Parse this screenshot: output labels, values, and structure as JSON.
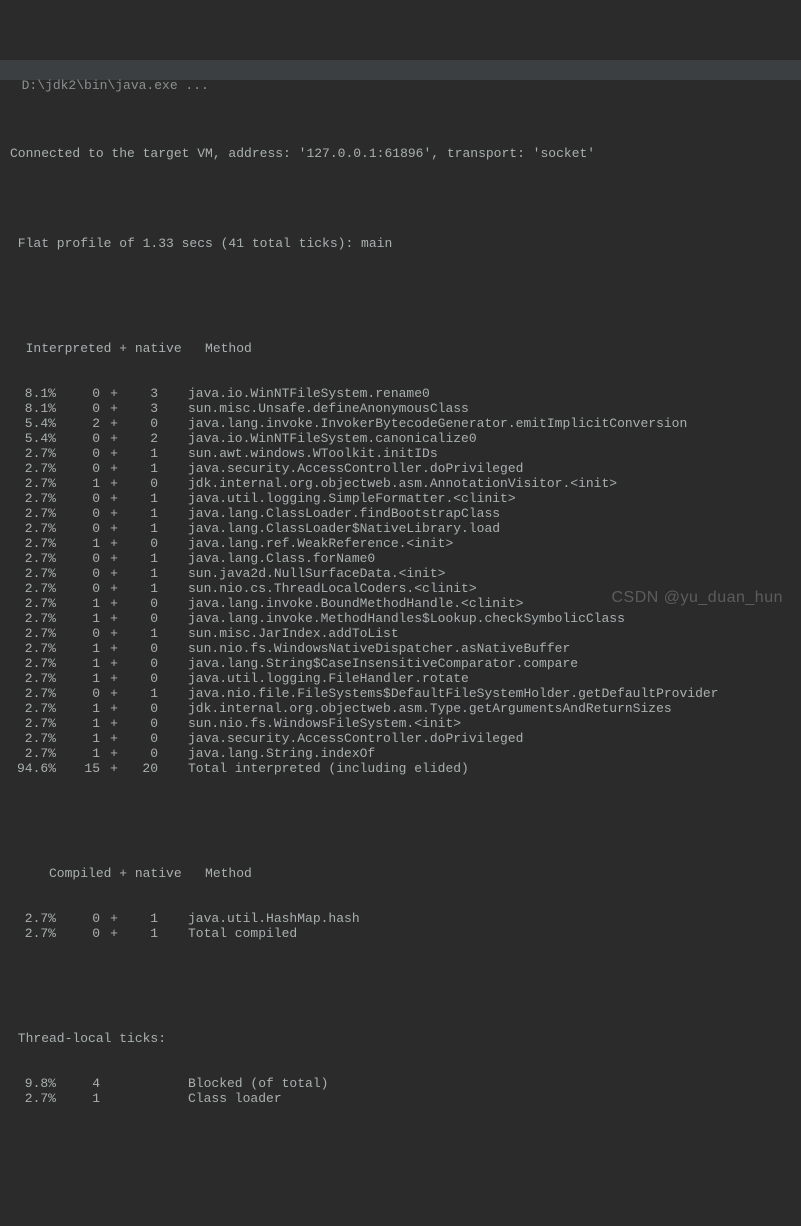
{
  "titlebar": {
    "text": "D:\\jdk2\\bin\\java.exe ..."
  },
  "header": {
    "connected": "Connected to the target VM, address: '127.0.0.1:61896', transport: 'socket'",
    "profile": " Flat profile of 1.33 secs (41 total ticks): main"
  },
  "section1": {
    "heading": "  Interpreted + native   Method",
    "rows": [
      {
        "pct": "8.1%",
        "a": "0",
        "b": "3",
        "method": "java.io.WinNTFileSystem.rename0"
      },
      {
        "pct": "8.1%",
        "a": "0",
        "b": "3",
        "method": "sun.misc.Unsafe.defineAnonymousClass"
      },
      {
        "pct": "5.4%",
        "a": "2",
        "b": "0",
        "method": "java.lang.invoke.InvokerBytecodeGenerator.emitImplicitConversion"
      },
      {
        "pct": "5.4%",
        "a": "0",
        "b": "2",
        "method": "java.io.WinNTFileSystem.canonicalize0"
      },
      {
        "pct": "2.7%",
        "a": "0",
        "b": "1",
        "method": "sun.awt.windows.WToolkit.initIDs"
      },
      {
        "pct": "2.7%",
        "a": "0",
        "b": "1",
        "method": "java.security.AccessController.doPrivileged"
      },
      {
        "pct": "2.7%",
        "a": "1",
        "b": "0",
        "method": "jdk.internal.org.objectweb.asm.AnnotationVisitor.<init>"
      },
      {
        "pct": "2.7%",
        "a": "0",
        "b": "1",
        "method": "java.util.logging.SimpleFormatter.<clinit>"
      },
      {
        "pct": "2.7%",
        "a": "0",
        "b": "1",
        "method": "java.lang.ClassLoader.findBootstrapClass"
      },
      {
        "pct": "2.7%",
        "a": "0",
        "b": "1",
        "method": "java.lang.ClassLoader$NativeLibrary.load"
      },
      {
        "pct": "2.7%",
        "a": "1",
        "b": "0",
        "method": "java.lang.ref.WeakReference.<init>"
      },
      {
        "pct": "2.7%",
        "a": "0",
        "b": "1",
        "method": "java.lang.Class.forName0"
      },
      {
        "pct": "2.7%",
        "a": "0",
        "b": "1",
        "method": "sun.java2d.NullSurfaceData.<init>"
      },
      {
        "pct": "2.7%",
        "a": "0",
        "b": "1",
        "method": "sun.nio.cs.ThreadLocalCoders.<clinit>"
      },
      {
        "pct": "2.7%",
        "a": "1",
        "b": "0",
        "method": "java.lang.invoke.BoundMethodHandle.<clinit>"
      },
      {
        "pct": "2.7%",
        "a": "1",
        "b": "0",
        "method": "java.lang.invoke.MethodHandles$Lookup.checkSymbolicClass"
      },
      {
        "pct": "2.7%",
        "a": "0",
        "b": "1",
        "method": "sun.misc.JarIndex.addToList"
      },
      {
        "pct": "2.7%",
        "a": "1",
        "b": "0",
        "method": "sun.nio.fs.WindowsNativeDispatcher.asNativeBuffer"
      },
      {
        "pct": "2.7%",
        "a": "1",
        "b": "0",
        "method": "java.lang.String$CaseInsensitiveComparator.compare"
      },
      {
        "pct": "2.7%",
        "a": "1",
        "b": "0",
        "method": "java.util.logging.FileHandler.rotate"
      },
      {
        "pct": "2.7%",
        "a": "0",
        "b": "1",
        "method": "java.nio.file.FileSystems$DefaultFileSystemHolder.getDefaultProvider"
      },
      {
        "pct": "2.7%",
        "a": "1",
        "b": "0",
        "method": "jdk.internal.org.objectweb.asm.Type.getArgumentsAndReturnSizes"
      },
      {
        "pct": "2.7%",
        "a": "1",
        "b": "0",
        "method": "sun.nio.fs.WindowsFileSystem.<init>"
      },
      {
        "pct": "2.7%",
        "a": "1",
        "b": "0",
        "method": "java.security.AccessController.doPrivileged"
      },
      {
        "pct": "2.7%",
        "a": "1",
        "b": "0",
        "method": "java.lang.String.indexOf"
      },
      {
        "pct": "94.6%",
        "a": "15",
        "b": "20",
        "method": "Total interpreted (including elided)"
      }
    ]
  },
  "section2": {
    "heading": "     Compiled + native   Method",
    "rows": [
      {
        "pct": "2.7%",
        "a": "0",
        "b": "1",
        "method": "java.util.HashMap.hash"
      },
      {
        "pct": "2.7%",
        "a": "0",
        "b": "1",
        "method": "Total compiled"
      }
    ]
  },
  "section3": {
    "heading": " Thread-local ticks:",
    "rows": [
      {
        "pct": "9.8%",
        "a": "4",
        "method": "Blocked (of total)"
      },
      {
        "pct": "2.7%",
        "a": "1",
        "method": "Class loader"
      }
    ]
  },
  "watermark": "CSDN @yu_duan_hun"
}
